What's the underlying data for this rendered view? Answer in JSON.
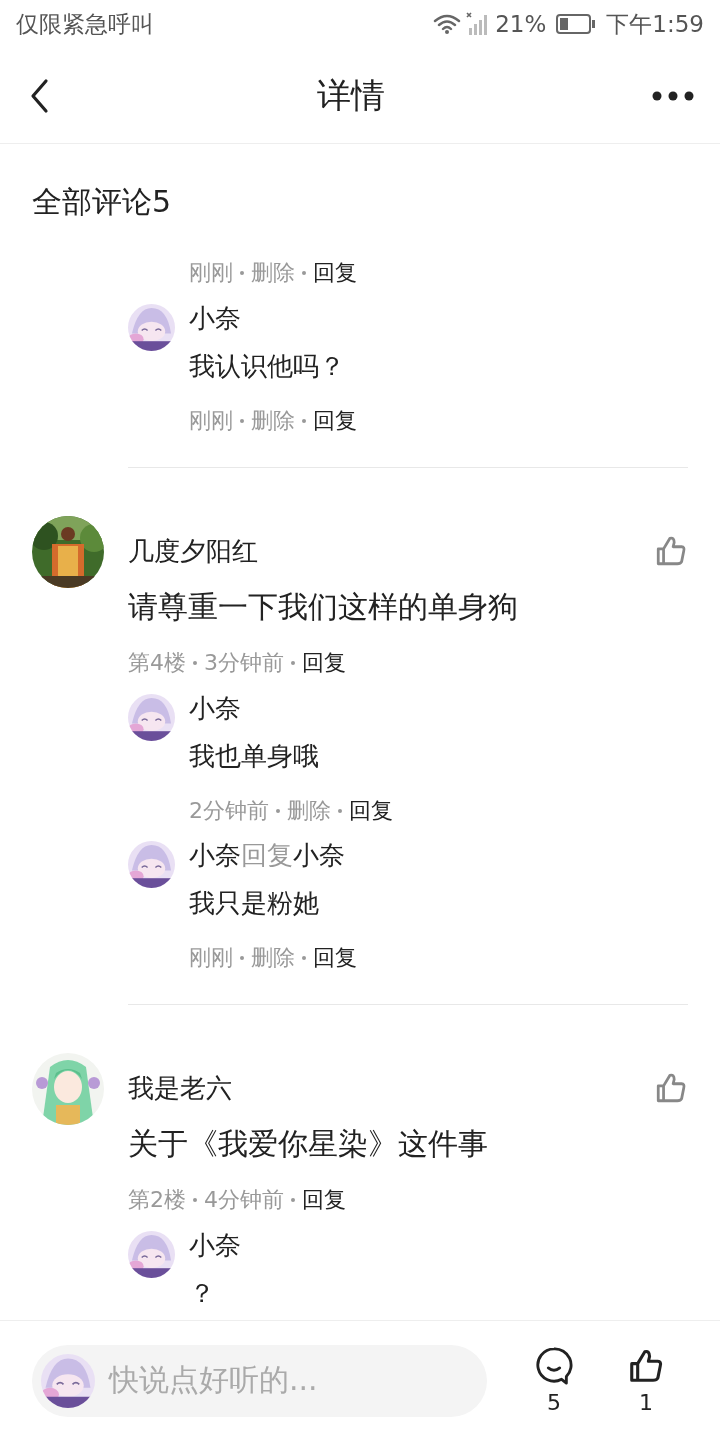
{
  "status_bar": {
    "carrier": "仅限紧急呼叫",
    "battery": "21%",
    "time": "下午1:59"
  },
  "header": {
    "title": "详情"
  },
  "comments_title": "全部评论5",
  "threads": [
    {
      "kind": "continued",
      "meta": [
        {
          "text": "刚刚",
          "kind": "muted"
        },
        {
          "text": "删除",
          "kind": "muted"
        },
        {
          "text": "回复",
          "kind": "action"
        }
      ],
      "replies": [
        {
          "name": "小奈",
          "text": "我认识他吗？",
          "meta": [
            {
              "text": "刚刚",
              "kind": "muted"
            },
            {
              "text": "删除",
              "kind": "muted"
            },
            {
              "text": "回复",
              "kind": "action"
            }
          ]
        }
      ]
    },
    {
      "kind": "comment",
      "name": "几度夕阳红",
      "text": "请尊重一下我们这样的单身狗",
      "meta": [
        {
          "text": "第4楼",
          "kind": "muted"
        },
        {
          "text": "3分钟前",
          "kind": "muted"
        },
        {
          "text": "回复",
          "kind": "action"
        }
      ],
      "replies": [
        {
          "name": "小奈",
          "text": "我也单身哦",
          "meta": [
            {
              "text": "2分钟前",
              "kind": "muted"
            },
            {
              "text": "删除",
              "kind": "muted"
            },
            {
              "text": "回复",
              "kind": "action"
            }
          ]
        },
        {
          "name": "小奈",
          "connector": "回复",
          "reply_to": "小奈",
          "text": "我只是粉她",
          "meta": [
            {
              "text": "刚刚",
              "kind": "muted"
            },
            {
              "text": "删除",
              "kind": "muted"
            },
            {
              "text": "回复",
              "kind": "action"
            }
          ]
        }
      ]
    },
    {
      "kind": "comment",
      "name": "我是老六",
      "text": "关于《我爱你星染》这件事",
      "meta": [
        {
          "text": "第2楼",
          "kind": "muted"
        },
        {
          "text": "4分钟前",
          "kind": "muted"
        },
        {
          "text": "回复",
          "kind": "action"
        }
      ],
      "replies": [
        {
          "name": "小奈",
          "text": "？"
        }
      ]
    }
  ],
  "bottom_bar": {
    "placeholder": "快说点好听的...",
    "comment_count": "5",
    "like_count": "1"
  }
}
